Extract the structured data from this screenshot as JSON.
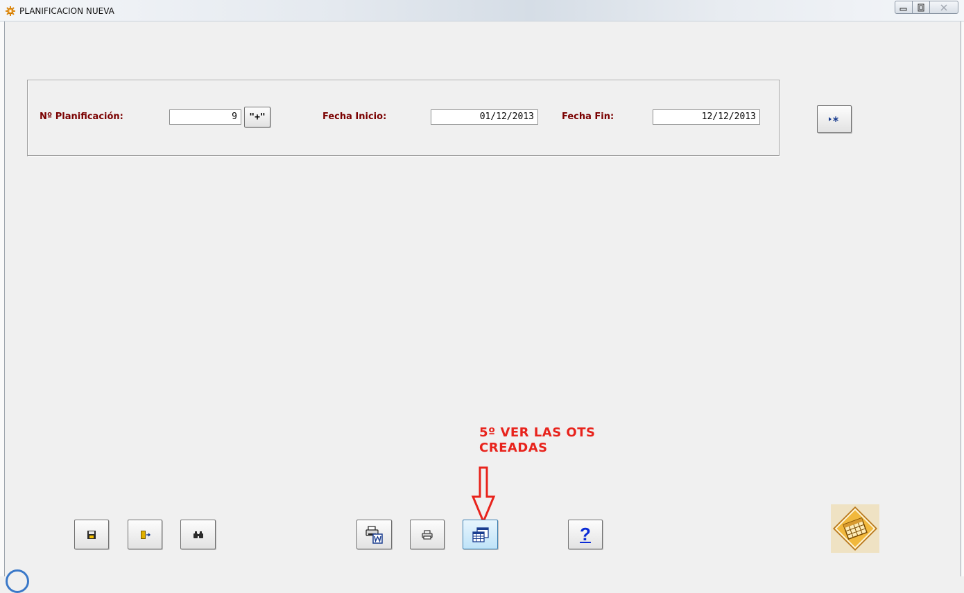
{
  "window": {
    "title": "PLANIFICACION NUEVA",
    "minimize_icon": "minimize-icon",
    "restore_icon": "restore-icon",
    "close_icon": "close-icon"
  },
  "form": {
    "plan_label": "Nº Planificación:",
    "plan_value": "9",
    "plus_button": "\"+\"",
    "start_label": "Fecha Inicio:",
    "start_value": "01/12/2013",
    "end_label": "Fecha Fin:",
    "end_value": "12/12/2013",
    "new_record_icon": "new-record-icon"
  },
  "toolbar": {
    "save_icon": "save-icon",
    "exit_icon": "exit-door-icon",
    "search_icon": "binoculars-icon",
    "word_print_icon": "print-word-icon",
    "print_icon": "printer-icon",
    "view_ots_icon": "grid-table-icon",
    "help_label": "?"
  },
  "annotation": {
    "line1": "5º VER LAS OTS",
    "line2": "CREADAS",
    "color": "#e8231c"
  },
  "colors": {
    "label": "#7a0000",
    "background": "#f0f0f0",
    "help": "#0a2bd6"
  }
}
